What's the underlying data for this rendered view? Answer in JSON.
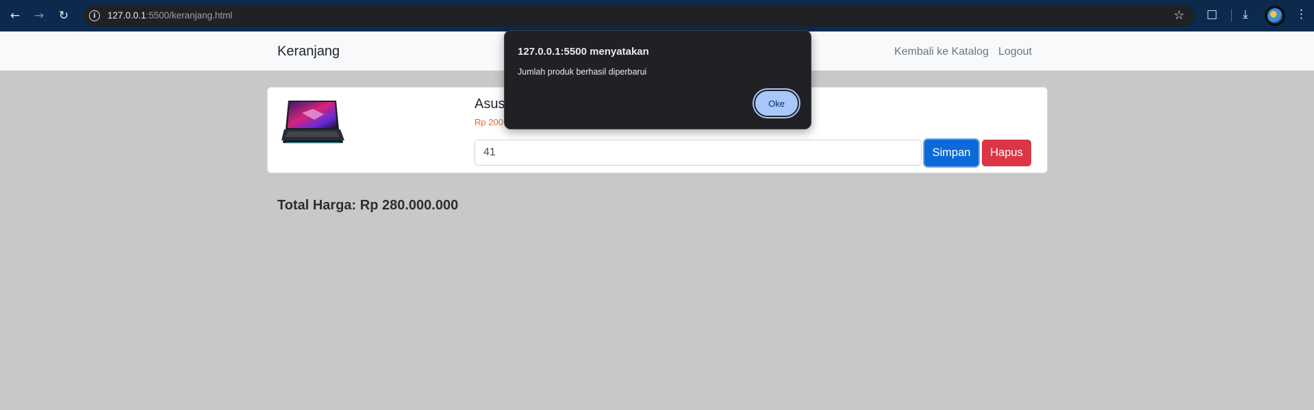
{
  "browser": {
    "url_host": "127.0.0.1",
    "url_rest": ":5500/keranjang.html",
    "icons": [
      "back-arrow-icon",
      "forward-arrow-icon",
      "reload-icon",
      "site-info-icon",
      "bookmark-star-icon",
      "extensions-icon",
      "download-icon",
      "profile-avatar",
      "more-menu-icon"
    ]
  },
  "navbar": {
    "brand": "Keranjang",
    "links": [
      "Kembali ke Katalog",
      "Logout"
    ]
  },
  "cart": {
    "items": [
      {
        "name": "Asus",
        "price": "Rp 200",
        "quantity": "41",
        "save_label": "Simpan",
        "delete_label": "Hapus"
      }
    ],
    "total": "Total Harga: Rp 280.000.000"
  },
  "dialog": {
    "title": "127.0.0.1:5500 menyatakan",
    "message": "Jumlah produk berhasil diperbarui",
    "ok_label": "Oke"
  },
  "colors": {
    "primary": "#0b6ad9",
    "danger": "#dc3545",
    "price": "#dc6c3a",
    "backdrop": "#c8c8c8"
  }
}
